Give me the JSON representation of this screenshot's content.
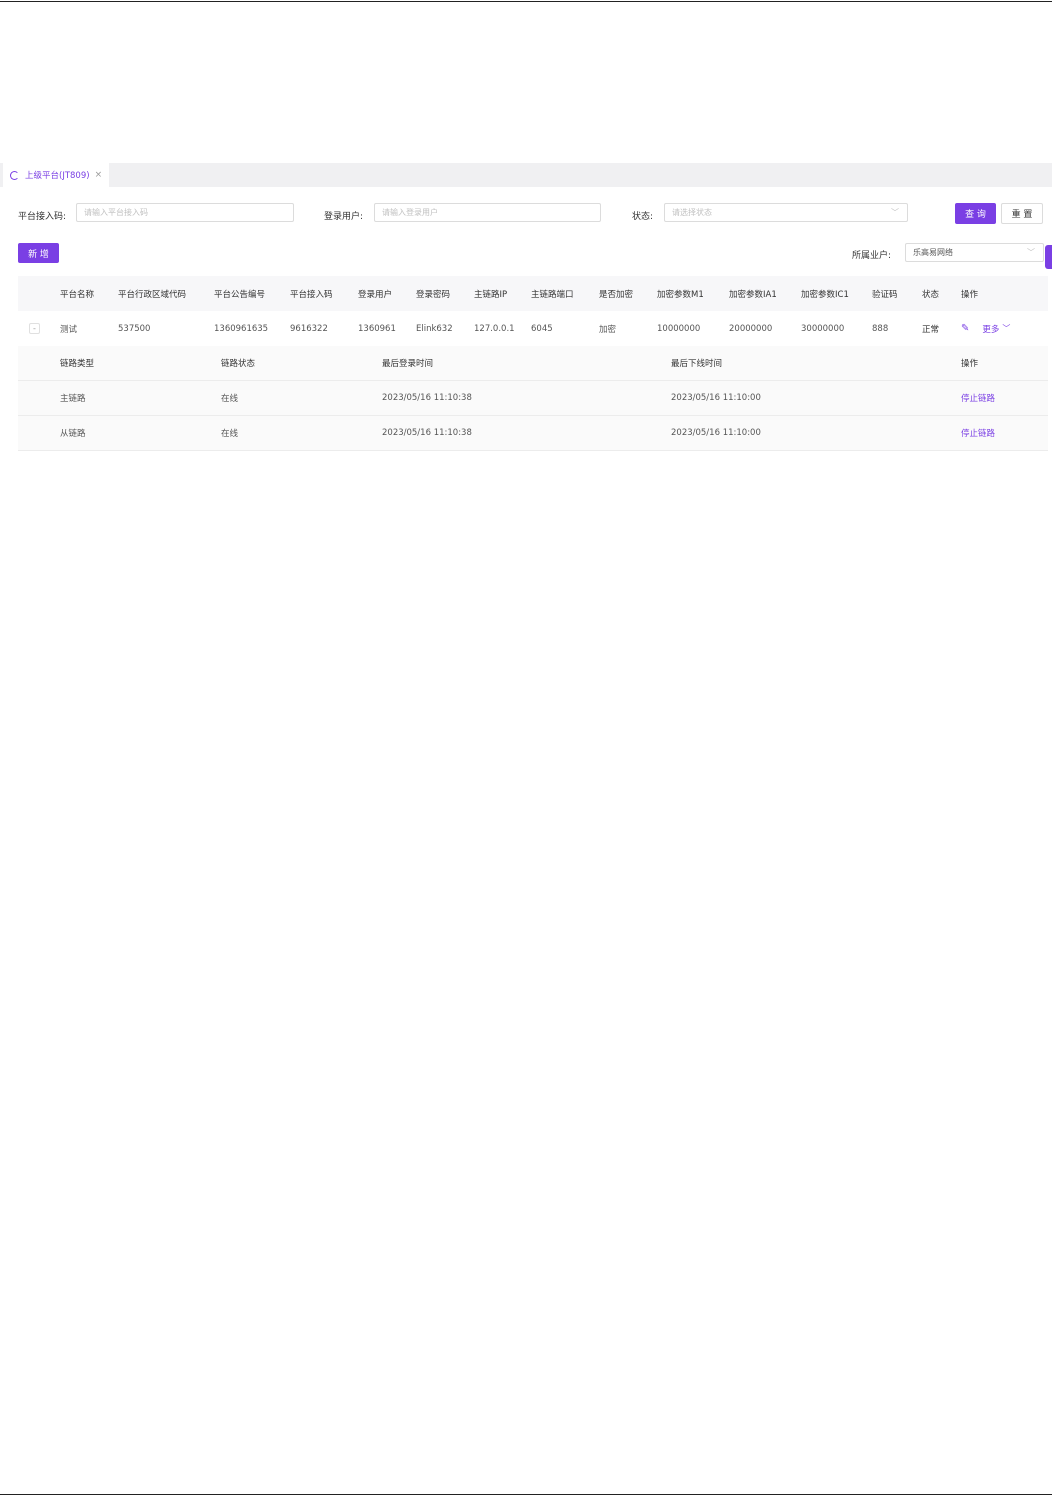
{
  "tab": {
    "label": "上级平台(JT809)",
    "close": "×"
  },
  "search": {
    "access_code_label": "平台接入码:",
    "access_code_placeholder": "请输入平台接入码",
    "login_user_label": "登录用户:",
    "login_user_placeholder": "请输入登录用户",
    "status_label": "状态:",
    "status_placeholder": "请选择状态",
    "query_button": "查 询",
    "reset_button": "重 置"
  },
  "toolbar": {
    "add_button": "新 增",
    "tenant_label": "所属业户:",
    "tenant_value": "乐高易网络"
  },
  "table": {
    "headers": [
      "平台名称",
      "平台行政区域代码",
      "平台公告编号",
      "平台接入码",
      "登录用户",
      "登录密码",
      "主链路IP",
      "主链路端口",
      "是否加密",
      "加密参数M1",
      "加密参数IA1",
      "加密参数IC1",
      "验证码",
      "状态",
      "操作"
    ],
    "rows": [
      {
        "expander": "-",
        "cells": [
          "测试",
          "537500",
          "1360961635",
          "9616322",
          "1360961",
          "Elink632",
          "127.0.0.1",
          "6045",
          "加密",
          "10000000",
          "20000000",
          "30000000",
          "888",
          "正常"
        ],
        "more": "更多"
      }
    ]
  },
  "subtable": {
    "headers": [
      "链路类型",
      "链路状态",
      "最后登录时间",
      "最后下线时间",
      "操作"
    ],
    "rows": [
      [
        "主链路",
        "在线",
        "2023/05/16 11:10:38",
        "2023/05/16 11:10:00",
        "停止链路"
      ],
      [
        "从链路",
        "在线",
        "2023/05/16 11:10:38",
        "2023/05/16 11:10:00",
        "停止链路"
      ]
    ]
  }
}
